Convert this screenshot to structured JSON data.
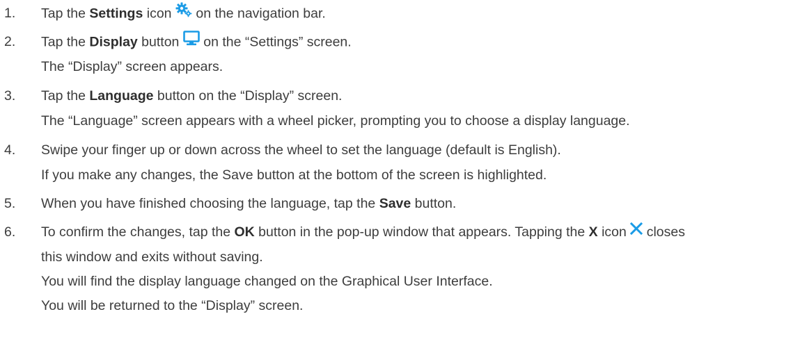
{
  "steps": [
    {
      "number": "1.",
      "line1": {
        "before": "Tap the ",
        "bold": "Settings",
        "middle": " icon ",
        "icon": "settings-gears-icon",
        "after": " on the navigation bar."
      }
    },
    {
      "number": "2.",
      "line1": {
        "before": "Tap the ",
        "bold": "Display",
        "middle": " button ",
        "icon": "monitor-icon",
        "after": " on the “Settings” screen."
      },
      "line2": "The “Display” screen appears."
    },
    {
      "number": "3.",
      "line1": {
        "before": "Tap the ",
        "bold": "Language",
        "after": " button on the “Display” screen."
      },
      "line2": "The “Language” screen appears with a wheel picker, prompting you to choose a display language."
    },
    {
      "number": "4.",
      "line1": "Swipe your finger up or down across the wheel to set the language (default is English).",
      "line2": "If you make any changes, the Save button at the bottom of the screen is highlighted."
    },
    {
      "number": "5.",
      "line1": {
        "before": "When you have finished choosing the language, tap the ",
        "bold": "Save",
        "after": " button."
      }
    },
    {
      "number": "6.",
      "line1": {
        "before": "To confirm the changes, tap the ",
        "bold": "OK",
        "middle": " button in the pop-up window that appears. Tapping the ",
        "bold2": "X",
        "middle2": " icon ",
        "icon": "close-x-icon",
        "after": " closes"
      },
      "line2": "this window and exits without saving.",
      "line3": "You will find the display language changed on the Graphical User Interface.",
      "line4": "You will be returned to the “Display” screen."
    }
  ],
  "colors": {
    "text": "#3d3d3d",
    "icon_accent": "#1a9be6"
  }
}
